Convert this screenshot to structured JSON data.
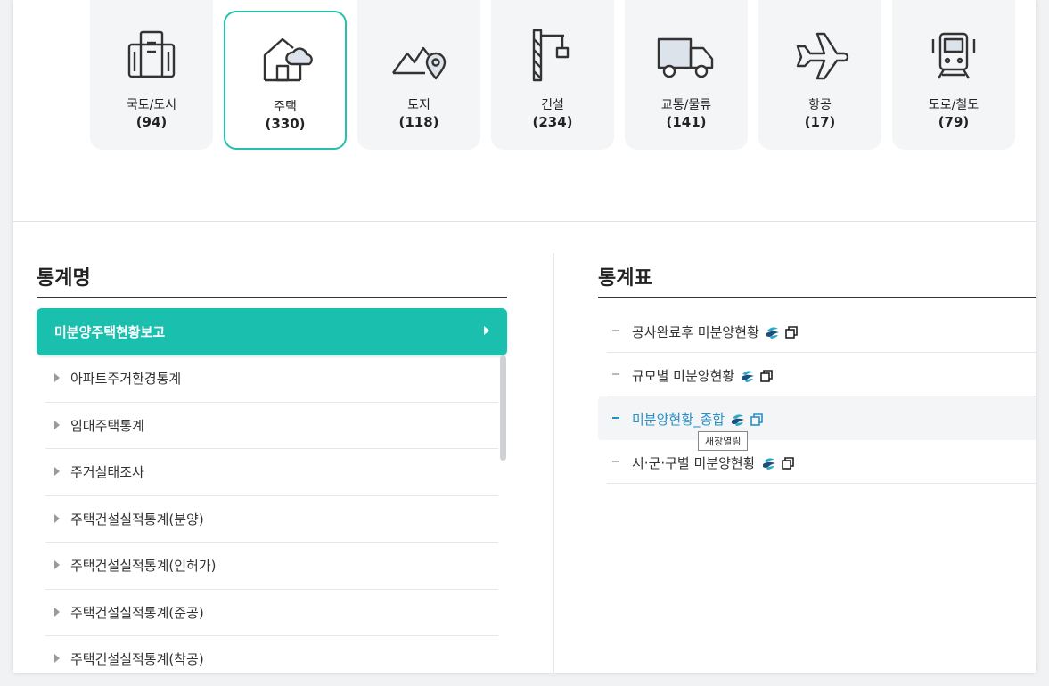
{
  "categories": [
    {
      "name": "국토/도시",
      "count": "(94)",
      "icon": "building-icon"
    },
    {
      "name": "주택",
      "count": "(330)",
      "icon": "house-cloud-icon",
      "active": true
    },
    {
      "name": "토지",
      "count": "(118)",
      "icon": "land-pin-icon"
    },
    {
      "name": "건설",
      "count": "(234)",
      "icon": "crane-icon"
    },
    {
      "name": "교통/물류",
      "count": "(141)",
      "icon": "truck-icon"
    },
    {
      "name": "항공",
      "count": "(17)",
      "icon": "airplane-icon"
    },
    {
      "name": "도로/철도",
      "count": "(79)",
      "icon": "train-icon"
    }
  ],
  "left": {
    "title": "통계명",
    "active_item": "미분양주택현황보고",
    "items": [
      "아파트주거환경통계",
      "임대주택통계",
      "주거실태조사",
      "주택건설실적통계(분양)",
      "주택건설실적통계(인허가)",
      "주택건설실적통계(준공)",
      "주택건설실적통계(착공)"
    ]
  },
  "right": {
    "title": "통계표",
    "items": [
      "공사완료후 미분양현황",
      "규모별 미분양현황",
      "미분양현황_종합",
      "시·군·구별 미분양현황"
    ],
    "tooltip": "새창열림"
  },
  "colors": {
    "accent": "#1bbfae",
    "link": "#2a8fc7"
  }
}
